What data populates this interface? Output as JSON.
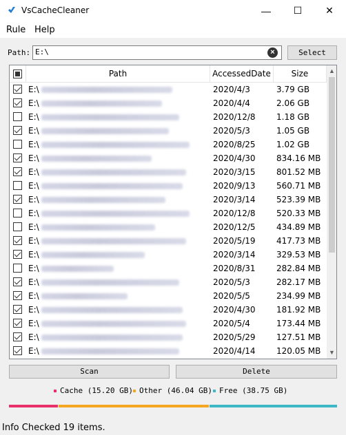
{
  "window": {
    "title": "VsCacheCleaner",
    "minimize_glyph": "—",
    "maximize_glyph": "☐",
    "close_glyph": "✕"
  },
  "menu": {
    "items": [
      "Rule",
      "Help"
    ]
  },
  "path": {
    "label": "Path:",
    "value": "E:\\",
    "select_label": "Select",
    "clear_icon": "x-circle-icon"
  },
  "table": {
    "columns": {
      "path": "Path",
      "date": "AccessedDate",
      "size": "Size"
    },
    "sorted_by": "Size",
    "rows": [
      {
        "checked": true,
        "path": "E:\\",
        "date": "2020/4/3",
        "size": "3.79 GB"
      },
      {
        "checked": true,
        "path": "E:\\",
        "date": "2020/4/4",
        "size": "2.06 GB"
      },
      {
        "checked": false,
        "path": "E:\\",
        "date": "2020/12/8",
        "size": "1.18 GB"
      },
      {
        "checked": true,
        "path": "E:\\",
        "date": "2020/5/3",
        "size": "1.05 GB"
      },
      {
        "checked": false,
        "path": "E:\\",
        "date": "2020/8/25",
        "size": "1.02 GB"
      },
      {
        "checked": true,
        "path": "E:\\",
        "date": "2020/4/30",
        "size": "834.16 MB"
      },
      {
        "checked": true,
        "path": "E:\\",
        "date": "2020/3/15",
        "size": "801.52 MB"
      },
      {
        "checked": false,
        "path": "E:\\",
        "date": "2020/9/13",
        "size": "560.71 MB"
      },
      {
        "checked": true,
        "path": "E:\\",
        "date": "2020/3/14",
        "size": "523.39 MB"
      },
      {
        "checked": false,
        "path": "E:\\",
        "date": "2020/12/8",
        "size": "520.33 MB"
      },
      {
        "checked": false,
        "path": "E:\\",
        "date": "2020/12/5",
        "size": "434.89 MB"
      },
      {
        "checked": true,
        "path": "E:\\",
        "date": "2020/5/19",
        "size": "417.73 MB"
      },
      {
        "checked": true,
        "path": "E:\\",
        "date": "2020/3/14",
        "size": "329.53 MB"
      },
      {
        "checked": false,
        "path": "E:\\",
        "date": "2020/8/31",
        "size": "282.84 MB"
      },
      {
        "checked": true,
        "path": "E:\\",
        "date": "2020/5/3",
        "size": "282.17 MB"
      },
      {
        "checked": true,
        "path": "E:\\",
        "date": "2020/5/5",
        "size": "234.99 MB"
      },
      {
        "checked": true,
        "path": "E:\\",
        "date": "2020/4/30",
        "size": "181.92 MB"
      },
      {
        "checked": true,
        "path": "E:\\",
        "date": "2020/5/4",
        "size": "173.44 MB"
      },
      {
        "checked": true,
        "path": "E:\\",
        "date": "2020/5/29",
        "size": "127.51 MB"
      },
      {
        "checked": true,
        "path": "E:\\",
        "date": "2020/4/14",
        "size": "120.05 MB"
      }
    ]
  },
  "buttons": {
    "scan": "Scan",
    "delete": "Delete"
  },
  "legend": [
    {
      "label": "Cache (15.20 GB)",
      "color": "#e8306a",
      "gb": 15.2
    },
    {
      "label": "Other (46.04 GB)",
      "color": "#f5a623",
      "gb": 46.04
    },
    {
      "label": "Free (38.75 GB)",
      "color": "#3db8c6",
      "gb": 38.75
    }
  ],
  "status": {
    "label": "Info",
    "message": "Checked 19 items."
  }
}
